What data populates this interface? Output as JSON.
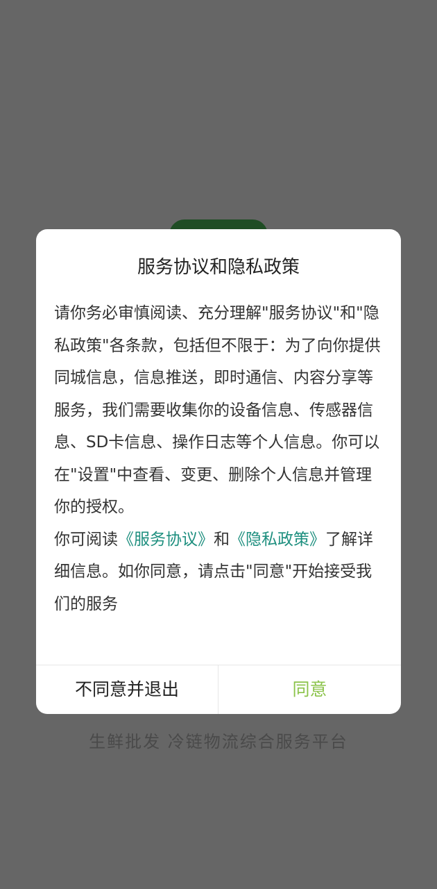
{
  "background": {
    "tagline": "生鲜批发 冷链物流综合服务平台"
  },
  "dialog": {
    "title": "服务协议和隐私政策",
    "paragraph1": "请你务必审慎阅读、充分理解\"服务协议\"和\"隐私政策\"各条款，包括但不限于：为了向你提供同城信息，信息推送，即时通信、内容分享等服务，我们需要收集你的设备信息、传感器信息、SD卡信息、操作日志等个人信息。你可以在\"设置\"中查看、变更、删除个人信息并管理你的授权。",
    "paragraph2": {
      "prefix": "你可阅读",
      "link_service": "《服务协议》",
      "middle": "和",
      "link_privacy": "《隐私政策》",
      "suffix": "了解详细信息。如你同意，请点击\"同意\"开始接受我们的服务"
    },
    "disagree_label": "不同意并退出",
    "agree_label": "同意"
  },
  "colors": {
    "overlay": "#666666",
    "link": "#1e8f7f",
    "agree": "#8bc34a",
    "logo": "#1f4d24"
  }
}
